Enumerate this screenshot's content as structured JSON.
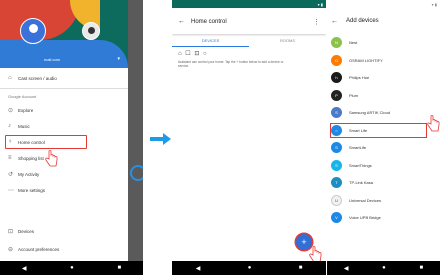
{
  "phone1": {
    "drawer": {
      "account_name": "mail.com",
      "items": [
        {
          "icon": "home-icon",
          "glyph": "⌂",
          "label": "Cast screen / audio"
        },
        {
          "icon": "compass-icon",
          "glyph": "⊙",
          "label": "Explore"
        },
        {
          "icon": "music-icon",
          "glyph": "♪",
          "label": "Music"
        },
        {
          "icon": "lightbulb-icon",
          "glyph": "♀",
          "label": "Home control"
        },
        {
          "icon": "list-icon",
          "glyph": "≡",
          "label": "Shopping list"
        },
        {
          "icon": "history-icon",
          "glyph": "↺",
          "label": "My Activity"
        },
        {
          "icon": "dots-icon",
          "glyph": "⋯",
          "label": "More settings"
        }
      ],
      "section_label": "Google Account",
      "bottom_items": [
        {
          "glyph": "⊡",
          "label": "Devices"
        },
        {
          "glyph": "⊖",
          "label": "Account preferences"
        }
      ]
    }
  },
  "phone2": {
    "title": "Home control",
    "tabs": [
      "DEVICES",
      "ROOMS"
    ],
    "room_icons": "⌂ ☐ ⊡ ○",
    "hint": "Assistant can control your home. Tap the + button below to add a device or service.",
    "fab_label": "+"
  },
  "phone3": {
    "title": "Add devices",
    "devices": [
      {
        "name": "Nest",
        "color": "#8bc34a",
        "abbr": "N"
      },
      {
        "name": "OSRAM LIGHTIFY",
        "color": "#ff7a00",
        "abbr": "O"
      },
      {
        "name": "Philips Hue",
        "color": "#1a1a1a",
        "abbr": "h"
      },
      {
        "name": "Plum",
        "color": "#222222",
        "abbr": "P"
      },
      {
        "name": "Samsung ARTIK Cloud",
        "color": "#4a7ac8",
        "abbr": "S"
      },
      {
        "name": "Smart Life",
        "color": "#1e88e5",
        "abbr": "⌂"
      },
      {
        "name": "SmartLife",
        "color": "#1e88e5",
        "abbr": "S"
      },
      {
        "name": "SmartThings",
        "color": "#19b5e8",
        "abbr": "S"
      },
      {
        "name": "TP-Link Kasa",
        "color": "#1c8fc0",
        "abbr": "T"
      },
      {
        "name": "Universal Devices",
        "color": "#f2f2f2",
        "abbr": "U"
      },
      {
        "name": "Voice UPB Bridge",
        "color": "#1e88e5",
        "abbr": "V"
      }
    ]
  },
  "nav": {
    "back": "◀",
    "home": "●",
    "recent": "■"
  }
}
